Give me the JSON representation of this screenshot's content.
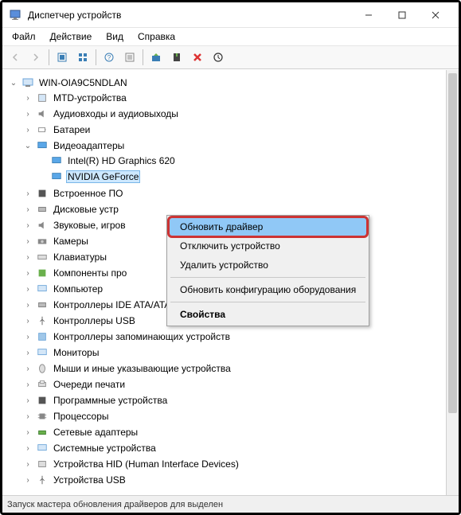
{
  "window": {
    "title": "Диспетчер устройств"
  },
  "menu": {
    "file": "Файл",
    "action": "Действие",
    "view": "Вид",
    "help": "Справка"
  },
  "tree": {
    "root": "WIN-OIA9C5NDLAN",
    "items": {
      "mtd": "МТD-устройства",
      "audio": "Аудиовходы и аудиовыходы",
      "battery": "Батареи",
      "video": "Видеоадаптеры",
      "intel": "Intel(R) HD Graphics 620",
      "nvidia": "NVIDIA GeForce",
      "firmware": "Встроенное ПО",
      "disk": "Дисковые устр",
      "sound": "Звуковые, игров",
      "camera": "Камеры",
      "keyboard": "Клавиатуры",
      "software": "Компоненты про",
      "computer": "Компьютер",
      "ide": "Контроллеры IDE ATA/ATAPI",
      "usb_ctrl": "Контроллеры USB",
      "storage": "Контроллеры запоминающих устройств",
      "monitor": "Мониторы",
      "mouse": "Мыши и иные указывающие устройства",
      "print": "Очереди печати",
      "soft_dev": "Программные устройства",
      "cpu": "Процессоры",
      "net": "Сетевые адаптеры",
      "sys": "Системные устройства",
      "hid": "Устройства HID (Human Interface Devices)",
      "usb_dev": "Устройства USB"
    }
  },
  "contextmenu": {
    "update": "Обновить драйвер",
    "disable": "Отключить устройство",
    "delete": "Удалить устройство",
    "refresh": "Обновить конфигурацию оборудования",
    "properties": "Свойства"
  },
  "statusbar": {
    "text": "Запуск мастера обновления драйверов для выделен"
  }
}
